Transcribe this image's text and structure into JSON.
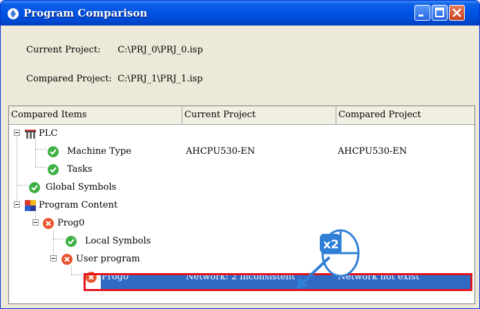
{
  "window": {
    "title": "Program Comparison"
  },
  "info": {
    "current_project": "Current Project:      C:\\PRJ_0\\PRJ_0.isp",
    "compared_project": "Compared Project:  C:\\PRJ_1\\PRJ_1.isp"
  },
  "table": {
    "headers": [
      "Compared Items",
      "Current Project",
      "Compared Project"
    ],
    "rows": [
      {
        "label": "PLC",
        "current": "",
        "compared": "",
        "icon": "plc-icon"
      },
      {
        "label": "Machine Type",
        "current": "AHCPU530-EN",
        "compared": "AHCPU530-EN",
        "icon": "check-icon"
      },
      {
        "label": "Tasks",
        "current": "",
        "compared": "",
        "icon": "check-icon"
      },
      {
        "label": "Global Symbols",
        "current": "",
        "compared": "",
        "icon": "check-icon"
      },
      {
        "label": "Program Content",
        "current": "",
        "compared": "",
        "icon": "program-content-icon"
      },
      {
        "label": "Prog0",
        "current": "",
        "compared": "",
        "icon": "error-icon"
      },
      {
        "label": "Local Symbols",
        "current": "",
        "compared": "",
        "icon": "check-icon"
      },
      {
        "label": "User program",
        "current": "",
        "compared": "",
        "icon": "error-icon"
      },
      {
        "label": "Prog0",
        "current": "Network: 2 inconsistent",
        "compared": "Network not exist",
        "icon": "error-icon",
        "selected": true
      }
    ]
  },
  "annotation": {
    "double_click_label": "x2"
  },
  "colors": {
    "selection": "#316ac5",
    "highlight_border": "#e2131c",
    "title_bar": "#0054e3"
  }
}
